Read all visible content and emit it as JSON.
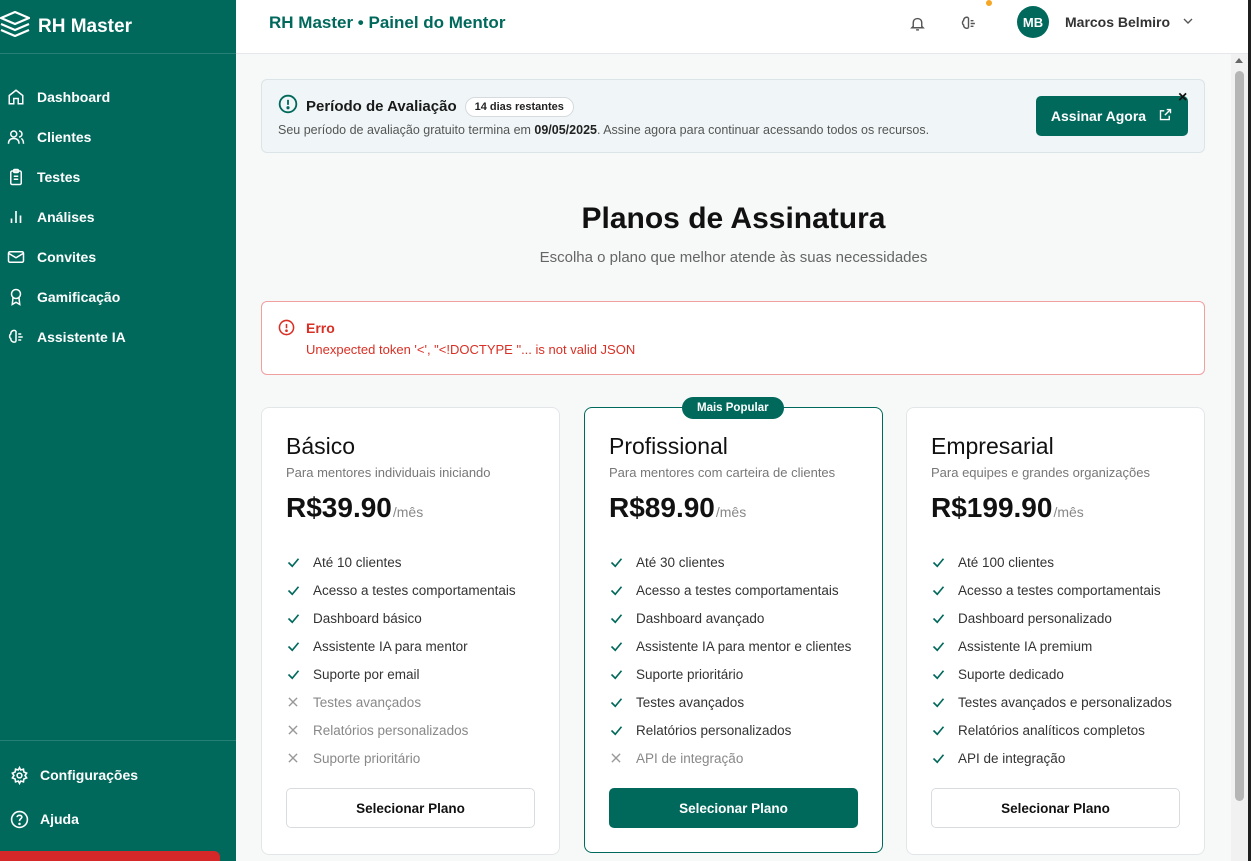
{
  "app": {
    "name": "RH Master",
    "header_title": "RH Master • Painel do Mentor"
  },
  "sidebar": {
    "items": [
      {
        "label": "Dashboard",
        "icon": "home-icon"
      },
      {
        "label": "Clientes",
        "icon": "users-icon"
      },
      {
        "label": "Testes",
        "icon": "clipboard-icon"
      },
      {
        "label": "Análises",
        "icon": "bar-chart-icon"
      },
      {
        "label": "Convites",
        "icon": "mail-icon"
      },
      {
        "label": "Gamificação",
        "icon": "award-icon"
      },
      {
        "label": "Assistente IA",
        "icon": "brain-icon"
      }
    ],
    "bottom": [
      {
        "label": "Configurações",
        "icon": "gear-icon"
      },
      {
        "label": "Ajuda",
        "icon": "help-icon"
      }
    ]
  },
  "user": {
    "initials": "MB",
    "name": "Marcos Belmiro"
  },
  "trial": {
    "title": "Período de Avaliação",
    "badge": "14 dias restantes",
    "text_before": "Seu período de avaliação gratuito termina em ",
    "date": "09/05/2025",
    "text_after": ". Assine agora para continuar acessando todos os recursos.",
    "button": "Assinar Agora",
    "close": "×"
  },
  "page": {
    "title": "Planos de Assinatura",
    "subtitle": "Escolha o plano que melhor atende às suas necessidades"
  },
  "error": {
    "title": "Erro",
    "message": "Unexpected token '<', \"<!DOCTYPE \"... is not valid JSON"
  },
  "plans": [
    {
      "name": "Básico",
      "description": "Para mentores individuais iniciando",
      "price": "R$39.90",
      "period": "/mês",
      "button": "Selecionar Plano",
      "features": [
        {
          "text": "Até 10 clientes",
          "included": true
        },
        {
          "text": "Acesso a testes comportamentais",
          "included": true
        },
        {
          "text": "Dashboard básico",
          "included": true
        },
        {
          "text": "Assistente IA para mentor",
          "included": true
        },
        {
          "text": "Suporte por email",
          "included": true
        },
        {
          "text": "Testes avançados",
          "included": false
        },
        {
          "text": "Relatórios personalizados",
          "included": false
        },
        {
          "text": "Suporte prioritário",
          "included": false
        }
      ]
    },
    {
      "name": "Profissional",
      "badge": "Mais Popular",
      "description": "Para mentores com carteira de clientes",
      "price": "R$89.90",
      "period": "/mês",
      "button": "Selecionar Plano",
      "features": [
        {
          "text": "Até 30 clientes",
          "included": true
        },
        {
          "text": "Acesso a testes comportamentais",
          "included": true
        },
        {
          "text": "Dashboard avançado",
          "included": true
        },
        {
          "text": "Assistente IA para mentor e clientes",
          "included": true
        },
        {
          "text": "Suporte prioritário",
          "included": true
        },
        {
          "text": "Testes avançados",
          "included": true
        },
        {
          "text": "Relatórios personalizados",
          "included": true
        },
        {
          "text": "API de integração",
          "included": false
        }
      ]
    },
    {
      "name": "Empresarial",
      "description": "Para equipes e grandes organizações",
      "price": "R$199.90",
      "period": "/mês",
      "button": "Selecionar Plano",
      "features": [
        {
          "text": "Até 100 clientes",
          "included": true
        },
        {
          "text": "Acesso a testes comportamentais",
          "included": true
        },
        {
          "text": "Dashboard personalizado",
          "included": true
        },
        {
          "text": "Assistente IA premium",
          "included": true
        },
        {
          "text": "Suporte dedicado",
          "included": true
        },
        {
          "text": "Testes avançados e personalizados",
          "included": true
        },
        {
          "text": "Relatórios analíticos completos",
          "included": true
        },
        {
          "text": "API de integração",
          "included": true
        }
      ]
    }
  ],
  "colors": {
    "brand": "#00695c",
    "error": "#d93025",
    "notification": "#f5a623"
  }
}
